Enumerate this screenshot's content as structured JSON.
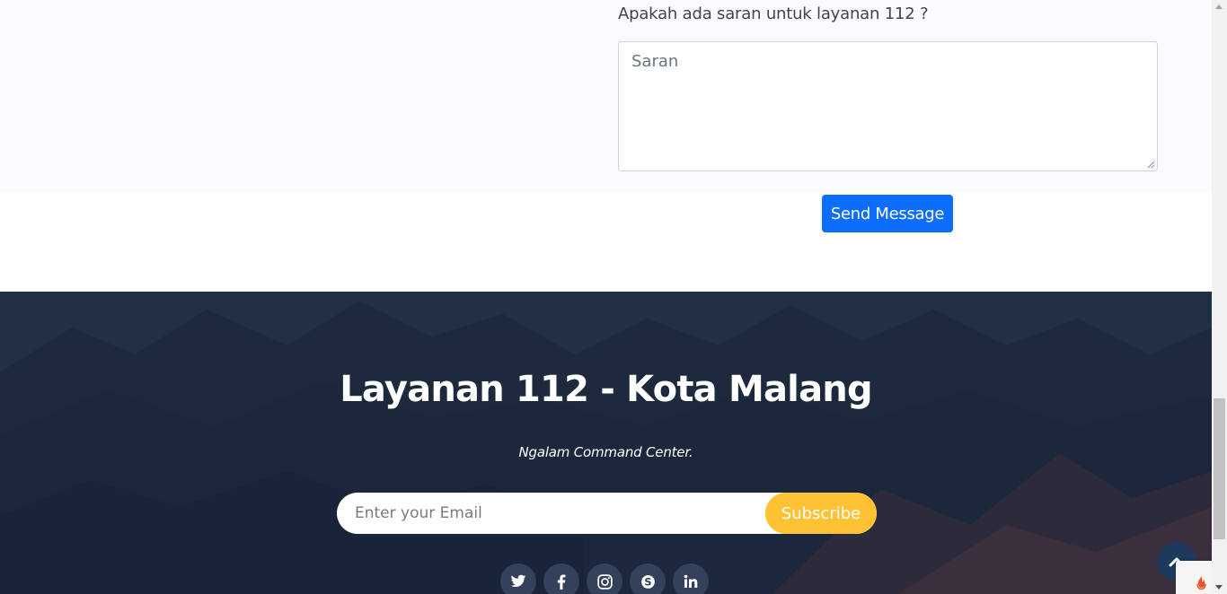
{
  "form": {
    "question": "Apakah ada saran untuk layanan 112 ?",
    "suggestion_placeholder": "Saran",
    "send_label": "Send Message"
  },
  "footer": {
    "title": "Layanan 112 - Kota Malang",
    "subtitle": "Ngalam Command Center.",
    "email_placeholder": "Enter your Email",
    "subscribe_label": "Subscribe",
    "social_icons": [
      "twitter-icon",
      "facebook-icon",
      "instagram-icon",
      "skype-icon",
      "linkedin-icon"
    ]
  },
  "colors": {
    "primary_button": "#0d6efd",
    "footer_bg": "#1d2a3d",
    "subscribe_accent": "#ffc235",
    "social_bg": "#34415a"
  }
}
